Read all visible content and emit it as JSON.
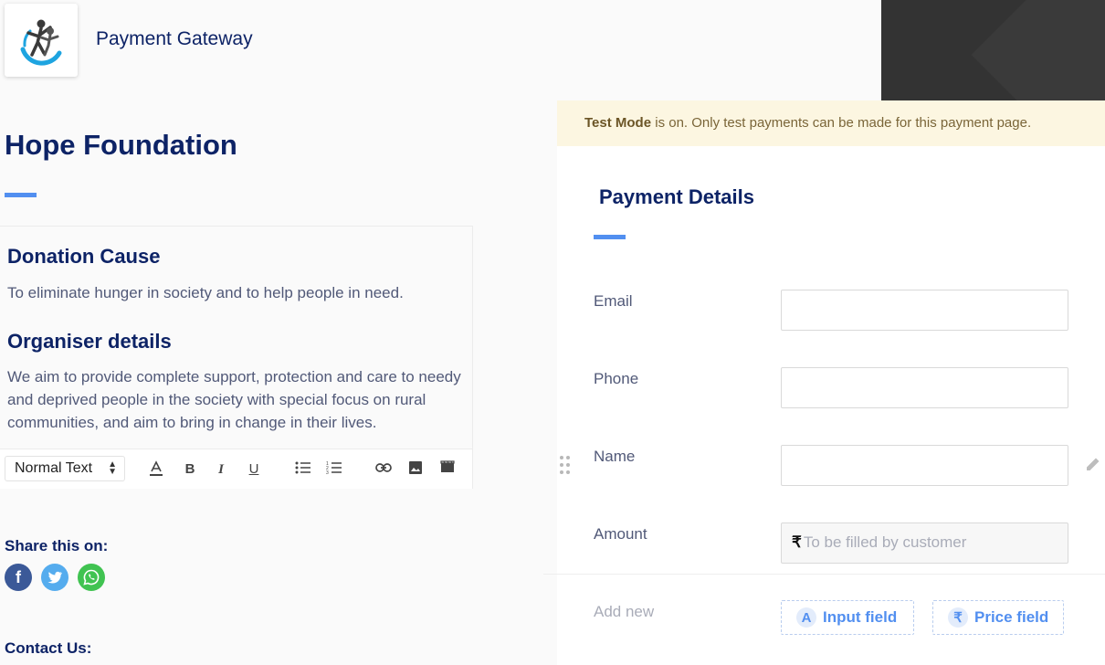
{
  "header": {
    "brand_title": "Payment Gateway",
    "logo_icon": "people-logo-icon"
  },
  "org": {
    "title": "Hope Foundation"
  },
  "description": {
    "cause_heading": "Donation Cause",
    "cause_text": "To eliminate hunger in society and to help people in need.",
    "organiser_heading": "Organiser details",
    "organiser_text": "We aim to provide complete support, protection and care to needy and deprived people in the society with special focus on rural communities, and aim to bring in change in their lives."
  },
  "toolbar": {
    "text_style": "Normal Text",
    "icons": [
      "text-color-icon",
      "bold-icon",
      "italic-icon",
      "underline-icon",
      "bullet-list-icon",
      "numbered-list-icon",
      "link-icon",
      "image-icon",
      "video-icon"
    ]
  },
  "share": {
    "title": "Share this on:",
    "networks": [
      {
        "name": "facebook-icon",
        "color": "#3b5998"
      },
      {
        "name": "twitter-icon",
        "color": "#55acee"
      },
      {
        "name": "whatsapp-icon",
        "color": "#40c351"
      }
    ]
  },
  "contact": {
    "title": "Contact Us:"
  },
  "banner": {
    "strong": "Test Mode",
    "text": " is on. Only test payments can be made for this payment page."
  },
  "payment": {
    "title": "Payment Details",
    "fields": [
      {
        "label": "Email",
        "value": ""
      },
      {
        "label": "Phone",
        "value": ""
      },
      {
        "label": "Name",
        "value": ""
      },
      {
        "label": "Amount",
        "currency": "₹",
        "placeholder": "To be filled by customer"
      }
    ],
    "add_new_label": "Add new",
    "input_field_label": "Input field",
    "price_field_label": "Price field",
    "input_field_glyph": "A",
    "price_field_glyph": "₹"
  },
  "colors": {
    "accent": "#528ff0",
    "heading": "#0d2366",
    "banner_bg": "#fcf6e1"
  }
}
